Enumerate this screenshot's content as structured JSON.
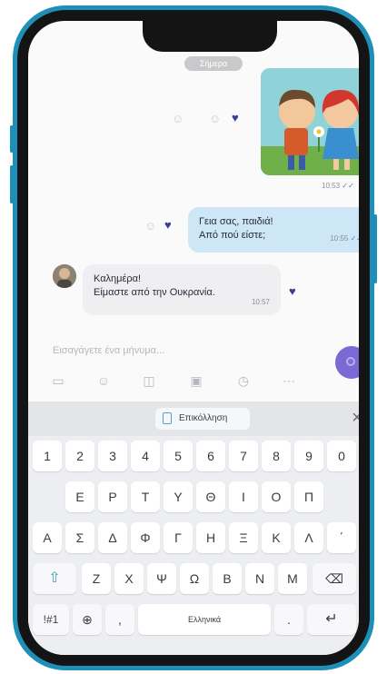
{
  "chat": {
    "date_label": "Σήμερα",
    "sticker_time": "10:53",
    "outgoing": {
      "line1": "Γεια σας, παιδιά!",
      "line2": "Από πού είστε;",
      "time": "10:55"
    },
    "incoming": {
      "line1": "Καλημέρα!",
      "line2": "Είμαστε από την Ουκρανία.",
      "time": "10:57"
    }
  },
  "composer": {
    "placeholder": "Εισαγάγετε ένα μήνυμα...",
    "toolbar_icons": [
      "gallery-icon",
      "sticker-icon",
      "camera-icon",
      "gif-icon",
      "timer-icon",
      "more-icon"
    ]
  },
  "keyboard": {
    "paste_label": "Επικόλληση",
    "close_glyph": "×",
    "rows": [
      [
        "1",
        "2",
        "3",
        "4",
        "5",
        "6",
        "7",
        "8",
        "9",
        "0"
      ],
      [
        "Ε",
        "Ρ",
        "Τ",
        "Υ",
        "Θ",
        "Ι",
        "Ο",
        "Π"
      ],
      [
        "Α",
        "Σ",
        "Δ",
        "Φ",
        "Γ",
        "Η",
        "Ξ",
        "Κ",
        "Λ",
        "΄"
      ],
      [
        "Ζ",
        "Χ",
        "Ψ",
        "Ω",
        "Β",
        "Ν",
        "Μ"
      ]
    ],
    "symbols_key": "!#1",
    "globe_glyph": "⊕",
    "comma_key": ",",
    "space_label": "Ελληνικά",
    "period_key": ".",
    "enter_glyph": "↵",
    "shift_glyph": "⇧",
    "backspace_glyph": "⌫"
  },
  "colors": {
    "phone_frame": "#1e8fb6",
    "outgoing_bubble": "#cde7f7",
    "heart": "#3b3e96",
    "send_button": "#7a6ad6"
  }
}
